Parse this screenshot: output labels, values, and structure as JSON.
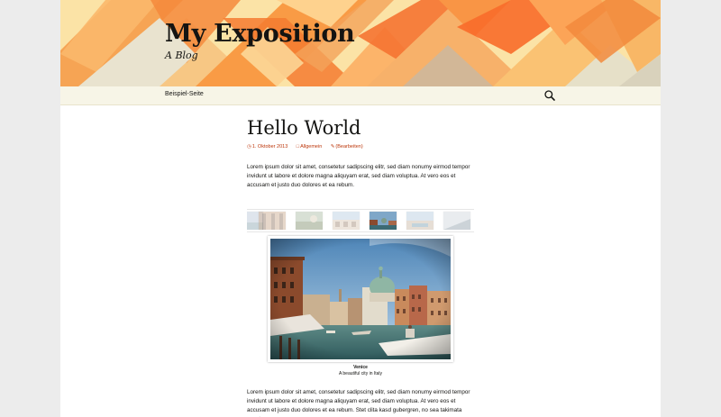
{
  "site": {
    "title": "My Exposition",
    "description": "A Blog"
  },
  "nav": {
    "items": [
      {
        "label": "Beispiel-Seite"
      }
    ],
    "search_icon": "search-icon"
  },
  "post": {
    "title": "Hello World",
    "meta": {
      "date": "1. Oktober 2013",
      "category": "Allgemein",
      "edit": "(Bearbeiten)"
    },
    "paragraph1": "Lorem ipsum dolor sit amet, consetetur sadipscing elitr, sed diam nonumy eirmod tempor invidunt ut labore et dolore magna aliquyam erat, sed diam voluptua. At vero eos et accusam et justo duo dolores et ea rebum.",
    "paragraph2": "Lorem ipsum dolor sit amet, consetetur sadipscing elitr, sed diam nonumy eirmod tempor invidunt ut labore et dolore magna aliquyam erat, sed diam voluptua. At vero eos et accusam et justo duo dolores et ea rebum. Stet clita kasd gubergren, no sea takimata sanctus"
  },
  "gallery": {
    "caption_title": "Venice",
    "caption_text": "A beautiful city in Italy"
  },
  "colors": {
    "accent": "#bc360a",
    "nav_bg": "#f7f5e7",
    "header_bg": "#f8c76e"
  }
}
